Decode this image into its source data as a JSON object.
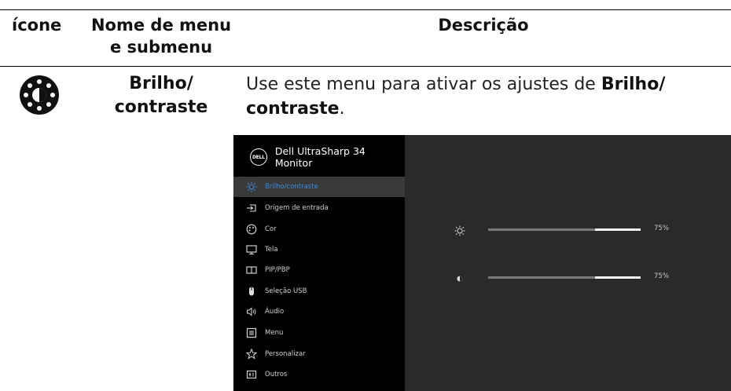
{
  "table": {
    "header": {
      "icon": "ícone",
      "name_line1": "Nome de menu",
      "name_line2": "e submenu",
      "description": "Descrição"
    },
    "row": {
      "icon": "brightness-contrast-icon",
      "name_line1": "Brilho/",
      "name_line2": "contraste",
      "desc_prefix": "Use este menu para ativar os ajustes de ",
      "desc_bold": "Brilho/ contraste",
      "desc_suffix": "."
    }
  },
  "osd": {
    "logo": "DELL",
    "title": "Dell UltraSharp 34 Monitor",
    "menu": [
      {
        "label": "Brilho/contraste",
        "icon": "sun-icon",
        "active": true
      },
      {
        "label": "Origem de entrada",
        "icon": "input-source-icon"
      },
      {
        "label": "Cor",
        "icon": "color-palette-icon"
      },
      {
        "label": "Tela",
        "icon": "display-icon"
      },
      {
        "label": "PIP/PBP",
        "icon": "pip-icon"
      },
      {
        "label": "Seleção USB",
        "icon": "usb-mouse-icon"
      },
      {
        "label": "Áudio",
        "icon": "speaker-icon"
      },
      {
        "label": "Menu",
        "icon": "menu-list-icon"
      },
      {
        "label": "Personalizar",
        "icon": "star-icon"
      },
      {
        "label": "Outros",
        "icon": "others-icon"
      }
    ],
    "sliders": [
      {
        "name": "brightness",
        "icon": "sun-icon",
        "value": 75,
        "label": "75%"
      },
      {
        "name": "contrast",
        "icon": "contrast-icon",
        "value": 75,
        "label": "75%"
      }
    ],
    "colors": {
      "accent": "#3d8fe0",
      "panel": "#000000",
      "main": "#2a2a2a"
    }
  }
}
